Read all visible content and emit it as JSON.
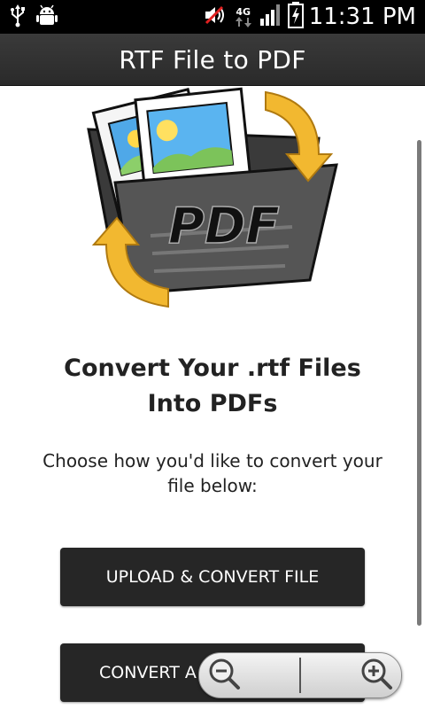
{
  "status_bar": {
    "time": "11:31 PM",
    "network": "4G",
    "icons": [
      "usb-icon",
      "android-debug-icon",
      "sound-muted-icon",
      "network-4g-icon",
      "signal-icon",
      "battery-charging-icon"
    ]
  },
  "app": {
    "title": "RTF File to PDF"
  },
  "main": {
    "logo_text": "PDF",
    "headline": "Convert Your .rtf Files Into PDFs",
    "subtext": "Choose how you'd like to convert your file below:",
    "buttons": {
      "upload": "UPLOAD & CONVERT FILE",
      "convert": "CONVERT A"
    }
  },
  "zoom": {
    "icons": [
      "zoom-out-icon",
      "zoom-in-icon"
    ]
  },
  "colors": {
    "status_bar_bg": "#000000",
    "title_bar_bg": "#2f2f2f",
    "button_bg": "#262626",
    "arrow_yellow": "#f2b830"
  }
}
